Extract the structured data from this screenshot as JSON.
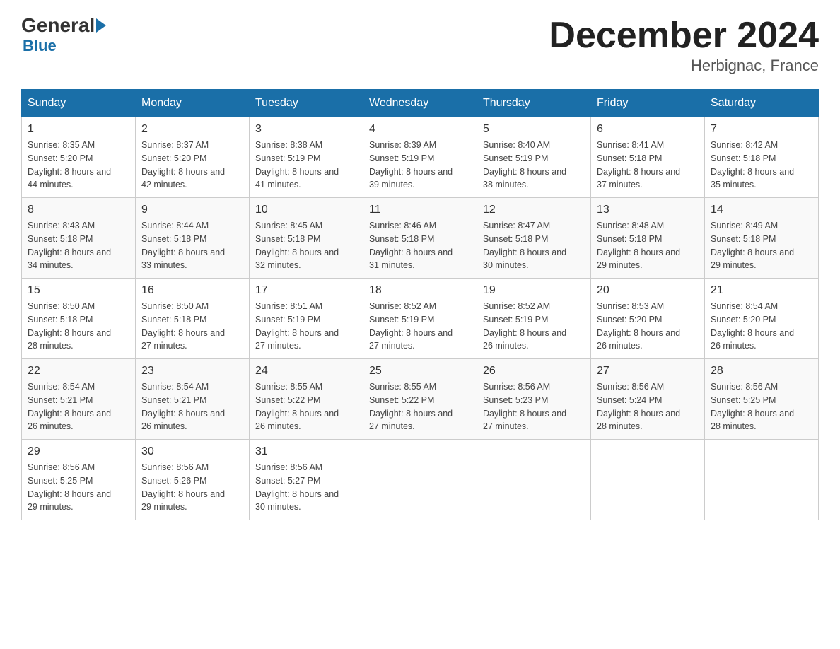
{
  "header": {
    "logo_general": "General",
    "logo_blue": "Blue",
    "month_title": "December 2024",
    "location": "Herbignac, France"
  },
  "days_of_week": [
    "Sunday",
    "Monday",
    "Tuesday",
    "Wednesday",
    "Thursday",
    "Friday",
    "Saturday"
  ],
  "weeks": [
    [
      {
        "day": "1",
        "sunrise": "8:35 AM",
        "sunset": "5:20 PM",
        "daylight": "8 hours and 44 minutes."
      },
      {
        "day": "2",
        "sunrise": "8:37 AM",
        "sunset": "5:20 PM",
        "daylight": "8 hours and 42 minutes."
      },
      {
        "day": "3",
        "sunrise": "8:38 AM",
        "sunset": "5:19 PM",
        "daylight": "8 hours and 41 minutes."
      },
      {
        "day": "4",
        "sunrise": "8:39 AM",
        "sunset": "5:19 PM",
        "daylight": "8 hours and 39 minutes."
      },
      {
        "day": "5",
        "sunrise": "8:40 AM",
        "sunset": "5:19 PM",
        "daylight": "8 hours and 38 minutes."
      },
      {
        "day": "6",
        "sunrise": "8:41 AM",
        "sunset": "5:18 PM",
        "daylight": "8 hours and 37 minutes."
      },
      {
        "day": "7",
        "sunrise": "8:42 AM",
        "sunset": "5:18 PM",
        "daylight": "8 hours and 35 minutes."
      }
    ],
    [
      {
        "day": "8",
        "sunrise": "8:43 AM",
        "sunset": "5:18 PM",
        "daylight": "8 hours and 34 minutes."
      },
      {
        "day": "9",
        "sunrise": "8:44 AM",
        "sunset": "5:18 PM",
        "daylight": "8 hours and 33 minutes."
      },
      {
        "day": "10",
        "sunrise": "8:45 AM",
        "sunset": "5:18 PM",
        "daylight": "8 hours and 32 minutes."
      },
      {
        "day": "11",
        "sunrise": "8:46 AM",
        "sunset": "5:18 PM",
        "daylight": "8 hours and 31 minutes."
      },
      {
        "day": "12",
        "sunrise": "8:47 AM",
        "sunset": "5:18 PM",
        "daylight": "8 hours and 30 minutes."
      },
      {
        "day": "13",
        "sunrise": "8:48 AM",
        "sunset": "5:18 PM",
        "daylight": "8 hours and 29 minutes."
      },
      {
        "day": "14",
        "sunrise": "8:49 AM",
        "sunset": "5:18 PM",
        "daylight": "8 hours and 29 minutes."
      }
    ],
    [
      {
        "day": "15",
        "sunrise": "8:50 AM",
        "sunset": "5:18 PM",
        "daylight": "8 hours and 28 minutes."
      },
      {
        "day": "16",
        "sunrise": "8:50 AM",
        "sunset": "5:18 PM",
        "daylight": "8 hours and 27 minutes."
      },
      {
        "day": "17",
        "sunrise": "8:51 AM",
        "sunset": "5:19 PM",
        "daylight": "8 hours and 27 minutes."
      },
      {
        "day": "18",
        "sunrise": "8:52 AM",
        "sunset": "5:19 PM",
        "daylight": "8 hours and 27 minutes."
      },
      {
        "day": "19",
        "sunrise": "8:52 AM",
        "sunset": "5:19 PM",
        "daylight": "8 hours and 26 minutes."
      },
      {
        "day": "20",
        "sunrise": "8:53 AM",
        "sunset": "5:20 PM",
        "daylight": "8 hours and 26 minutes."
      },
      {
        "day": "21",
        "sunrise": "8:54 AM",
        "sunset": "5:20 PM",
        "daylight": "8 hours and 26 minutes."
      }
    ],
    [
      {
        "day": "22",
        "sunrise": "8:54 AM",
        "sunset": "5:21 PM",
        "daylight": "8 hours and 26 minutes."
      },
      {
        "day": "23",
        "sunrise": "8:54 AM",
        "sunset": "5:21 PM",
        "daylight": "8 hours and 26 minutes."
      },
      {
        "day": "24",
        "sunrise": "8:55 AM",
        "sunset": "5:22 PM",
        "daylight": "8 hours and 26 minutes."
      },
      {
        "day": "25",
        "sunrise": "8:55 AM",
        "sunset": "5:22 PM",
        "daylight": "8 hours and 27 minutes."
      },
      {
        "day": "26",
        "sunrise": "8:56 AM",
        "sunset": "5:23 PM",
        "daylight": "8 hours and 27 minutes."
      },
      {
        "day": "27",
        "sunrise": "8:56 AM",
        "sunset": "5:24 PM",
        "daylight": "8 hours and 28 minutes."
      },
      {
        "day": "28",
        "sunrise": "8:56 AM",
        "sunset": "5:25 PM",
        "daylight": "8 hours and 28 minutes."
      }
    ],
    [
      {
        "day": "29",
        "sunrise": "8:56 AM",
        "sunset": "5:25 PM",
        "daylight": "8 hours and 29 minutes."
      },
      {
        "day": "30",
        "sunrise": "8:56 AM",
        "sunset": "5:26 PM",
        "daylight": "8 hours and 29 minutes."
      },
      {
        "day": "31",
        "sunrise": "8:56 AM",
        "sunset": "5:27 PM",
        "daylight": "8 hours and 30 minutes."
      },
      {
        "day": "",
        "sunrise": "",
        "sunset": "",
        "daylight": ""
      },
      {
        "day": "",
        "sunrise": "",
        "sunset": "",
        "daylight": ""
      },
      {
        "day": "",
        "sunrise": "",
        "sunset": "",
        "daylight": ""
      },
      {
        "day": "",
        "sunrise": "",
        "sunset": "",
        "daylight": ""
      }
    ]
  ],
  "labels": {
    "sunrise_prefix": "Sunrise: ",
    "sunset_prefix": "Sunset: ",
    "daylight_prefix": "Daylight: "
  }
}
